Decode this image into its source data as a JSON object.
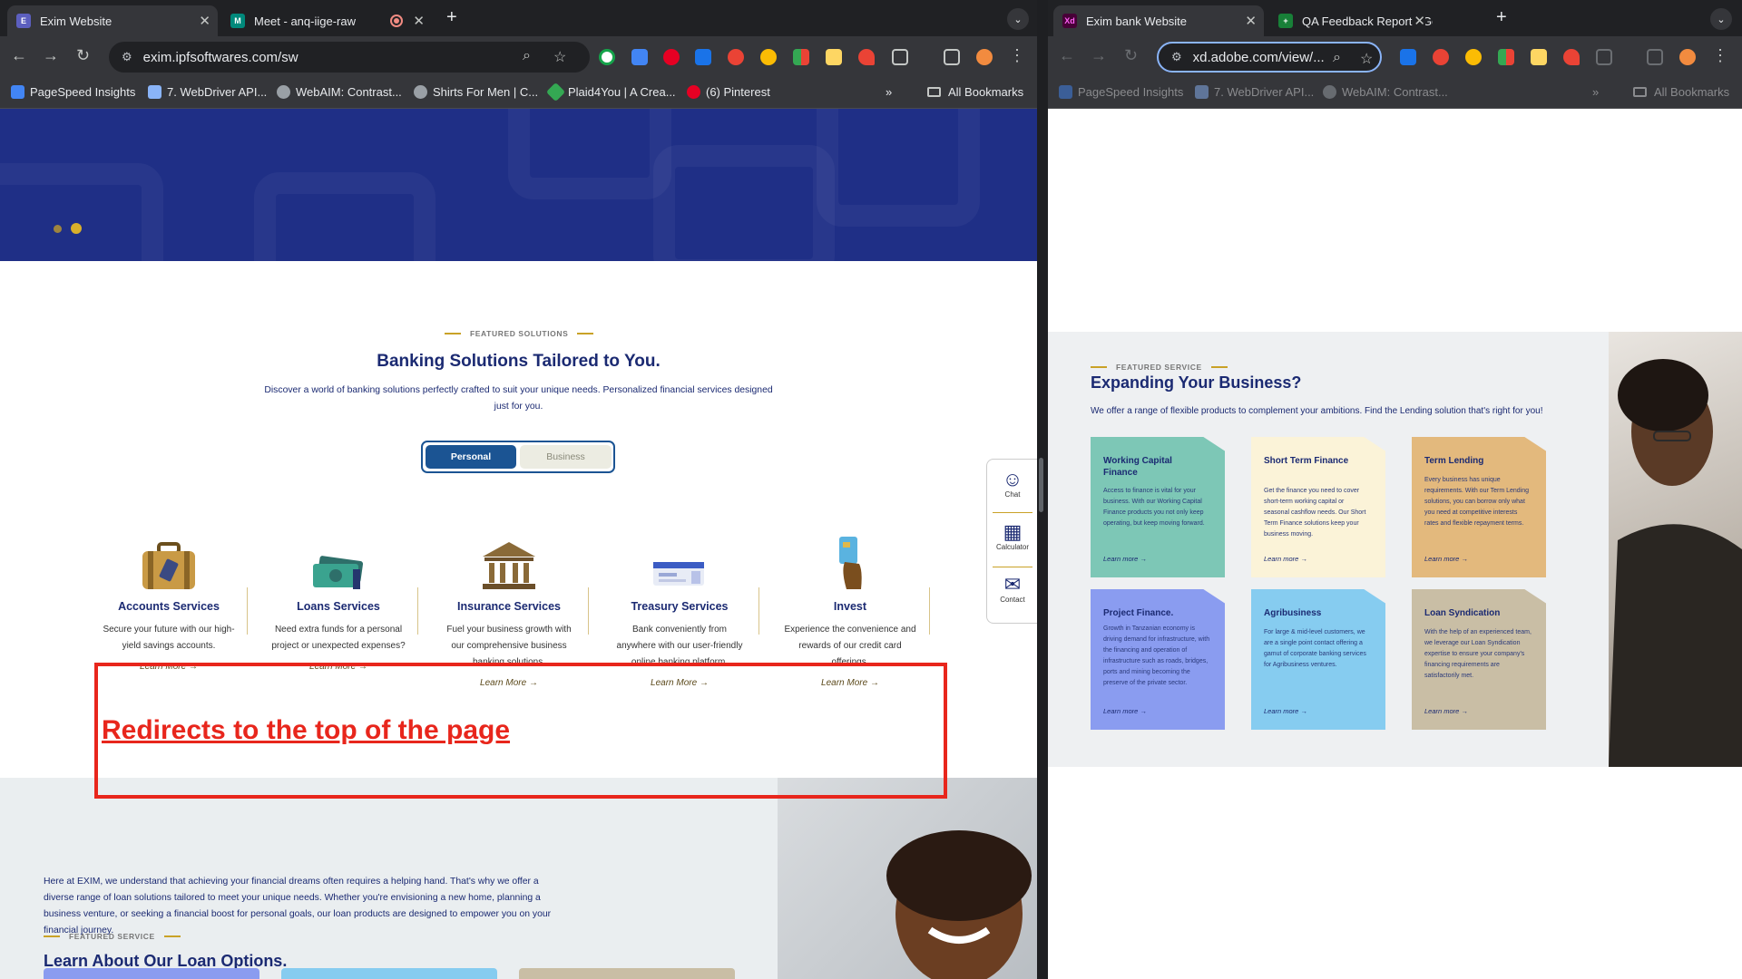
{
  "left": {
    "tabs": [
      {
        "label": "Exim Website",
        "fav_color": "#5c5fbf",
        "fav_glyph": "E"
      },
      {
        "label": "Meet - anq-iige-raw",
        "fav_color": "#00897b",
        "fav_glyph": "M"
      }
    ],
    "recording_icon": "record-icon",
    "url": "exim.ipfsoftwares.com/sw",
    "bookmarks": [
      {
        "label": "PageSpeed Insights",
        "color": "#4285f4"
      },
      {
        "label": "7. WebDriver API...",
        "color": "#8ab4f8"
      },
      {
        "label": "WebAIM: Contrast...",
        "color": "#9aa0a6"
      },
      {
        "label": "Shirts For Men | C...",
        "color": "#9aa0a6"
      },
      {
        "label": "Plaid4You | A Crea...",
        "color": "#34a853"
      },
      {
        "label": "(6) Pinterest",
        "color": "#e60023"
      }
    ],
    "all_bookmarks": "All Bookmarks",
    "section": {
      "kicker": "FEATURED SOLUTIONS",
      "title": "Banking Solutions Tailored to You.",
      "desc": "Discover a world of banking solutions perfectly crafted to suit your unique needs. Personalized financial services designed just for you.",
      "toggle": {
        "personal": "Personal",
        "business": "Business"
      }
    },
    "services": [
      {
        "title": "Accounts Services",
        "desc": "Secure your future with our high-yield savings accounts.",
        "link": "Learn More",
        "icon": "briefcase-icon"
      },
      {
        "title": "Loans Services",
        "desc": "Need extra funds for a personal project or unexpected expenses?",
        "link": "Learn More",
        "icon": "money-icon"
      },
      {
        "title": "Insurance Services",
        "desc": "Fuel your business growth with our comprehensive business banking solutions.",
        "link": "Learn More",
        "icon": "bank-building-icon"
      },
      {
        "title": "Treasury Services",
        "desc": "Bank conveniently from anywhere with our user-friendly online banking platform.",
        "link": "Learn More",
        "icon": "cards-icon"
      },
      {
        "title": "Invest",
        "desc": "Experience the convenience and rewards of our credit card offerings.",
        "link": "Learn More",
        "icon": "credit-card-icon"
      }
    ],
    "annotation": "Redirects to the top of the page",
    "sidebar": [
      {
        "label": "Chat"
      },
      {
        "label": "Calculator"
      },
      {
        "label": "Contact"
      }
    ],
    "loan": {
      "kicker": "FEATURED SERVICE",
      "title": "Learn About Our Loan Options.",
      "desc": "Here at EXIM, we understand that achieving your financial dreams often requires a helping hand. That's why we offer a diverse range of loan solutions tailored to meet your unique needs. Whether you're envisioning a new home, planning a business venture, or seeking a financial boost for personal goals, our loan products are designed to empower you on your financial journey."
    }
  },
  "right": {
    "tabs": [
      {
        "label": "Exim bank Website",
        "fav_color": "#470137",
        "fav_glyph": "Xd"
      },
      {
        "label": "QA Feedback Report - Google",
        "fav_color": "#188038",
        "fav_glyph": "+"
      }
    ],
    "url": "xd.adobe.com/view/...",
    "bookmarks": [
      {
        "label": "PageSpeed Insights",
        "color": "#4285f4"
      },
      {
        "label": "7. WebDriver API...",
        "color": "#8ab4f8"
      },
      {
        "label": "WebAIM: Contrast...",
        "color": "#9aa0a6"
      }
    ],
    "all_bookmarks": "All Bookmarks",
    "xd": {
      "kicker": "FEATURED SERVICE",
      "title": "Expanding Your Business?",
      "desc": "We offer a range of flexible products to complement your ambitions. Find the Lending solution that's right for you!",
      "cards": [
        {
          "title": "Working Capital Finance",
          "desc": "Access to finance is vital for your business. With our Working Capital Finance products you not only keep operating, but keep moving forward.",
          "link": "Learn more",
          "color": "#7dc7b6"
        },
        {
          "title": "Short Term Finance",
          "desc": "Get the finance you need to cover short-term working capital or seasonal cashflow needs. Our Short Term Finance solutions keep your business moving.",
          "link": "Learn more",
          "color": "#fbf3d8"
        },
        {
          "title": "Term Lending",
          "desc": "Every business has unique requirements. With our Term Lending solutions, you can borrow only what you need at competitive interests rates and flexible repayment terms.",
          "link": "Learn more",
          "color": "#e3b97d"
        },
        {
          "title": "Project Finance.",
          "desc": "Growth in Tanzanian economy is driving demand for infrastructure, with the financing and operation of infrastructure such as roads, bridges, ports and mining becoming the preserve of the private sector.",
          "link": "Learn more",
          "color": "#8a9cf0"
        },
        {
          "title": "Agribusiness",
          "desc": "For large & mid-level customers, we are a single point contact offering a gamut of corporate banking services for Agribusiness ventures.",
          "link": "Learn more",
          "color": "#86ccf0"
        },
        {
          "title": "Loan Syndication",
          "desc": "With the help of an experienced team, we leverage our Loan Syndication expertise to ensure your company's financing requirements are satisfactorily met.",
          "link": "Learn more",
          "color": "#c9bea5"
        }
      ]
    }
  }
}
